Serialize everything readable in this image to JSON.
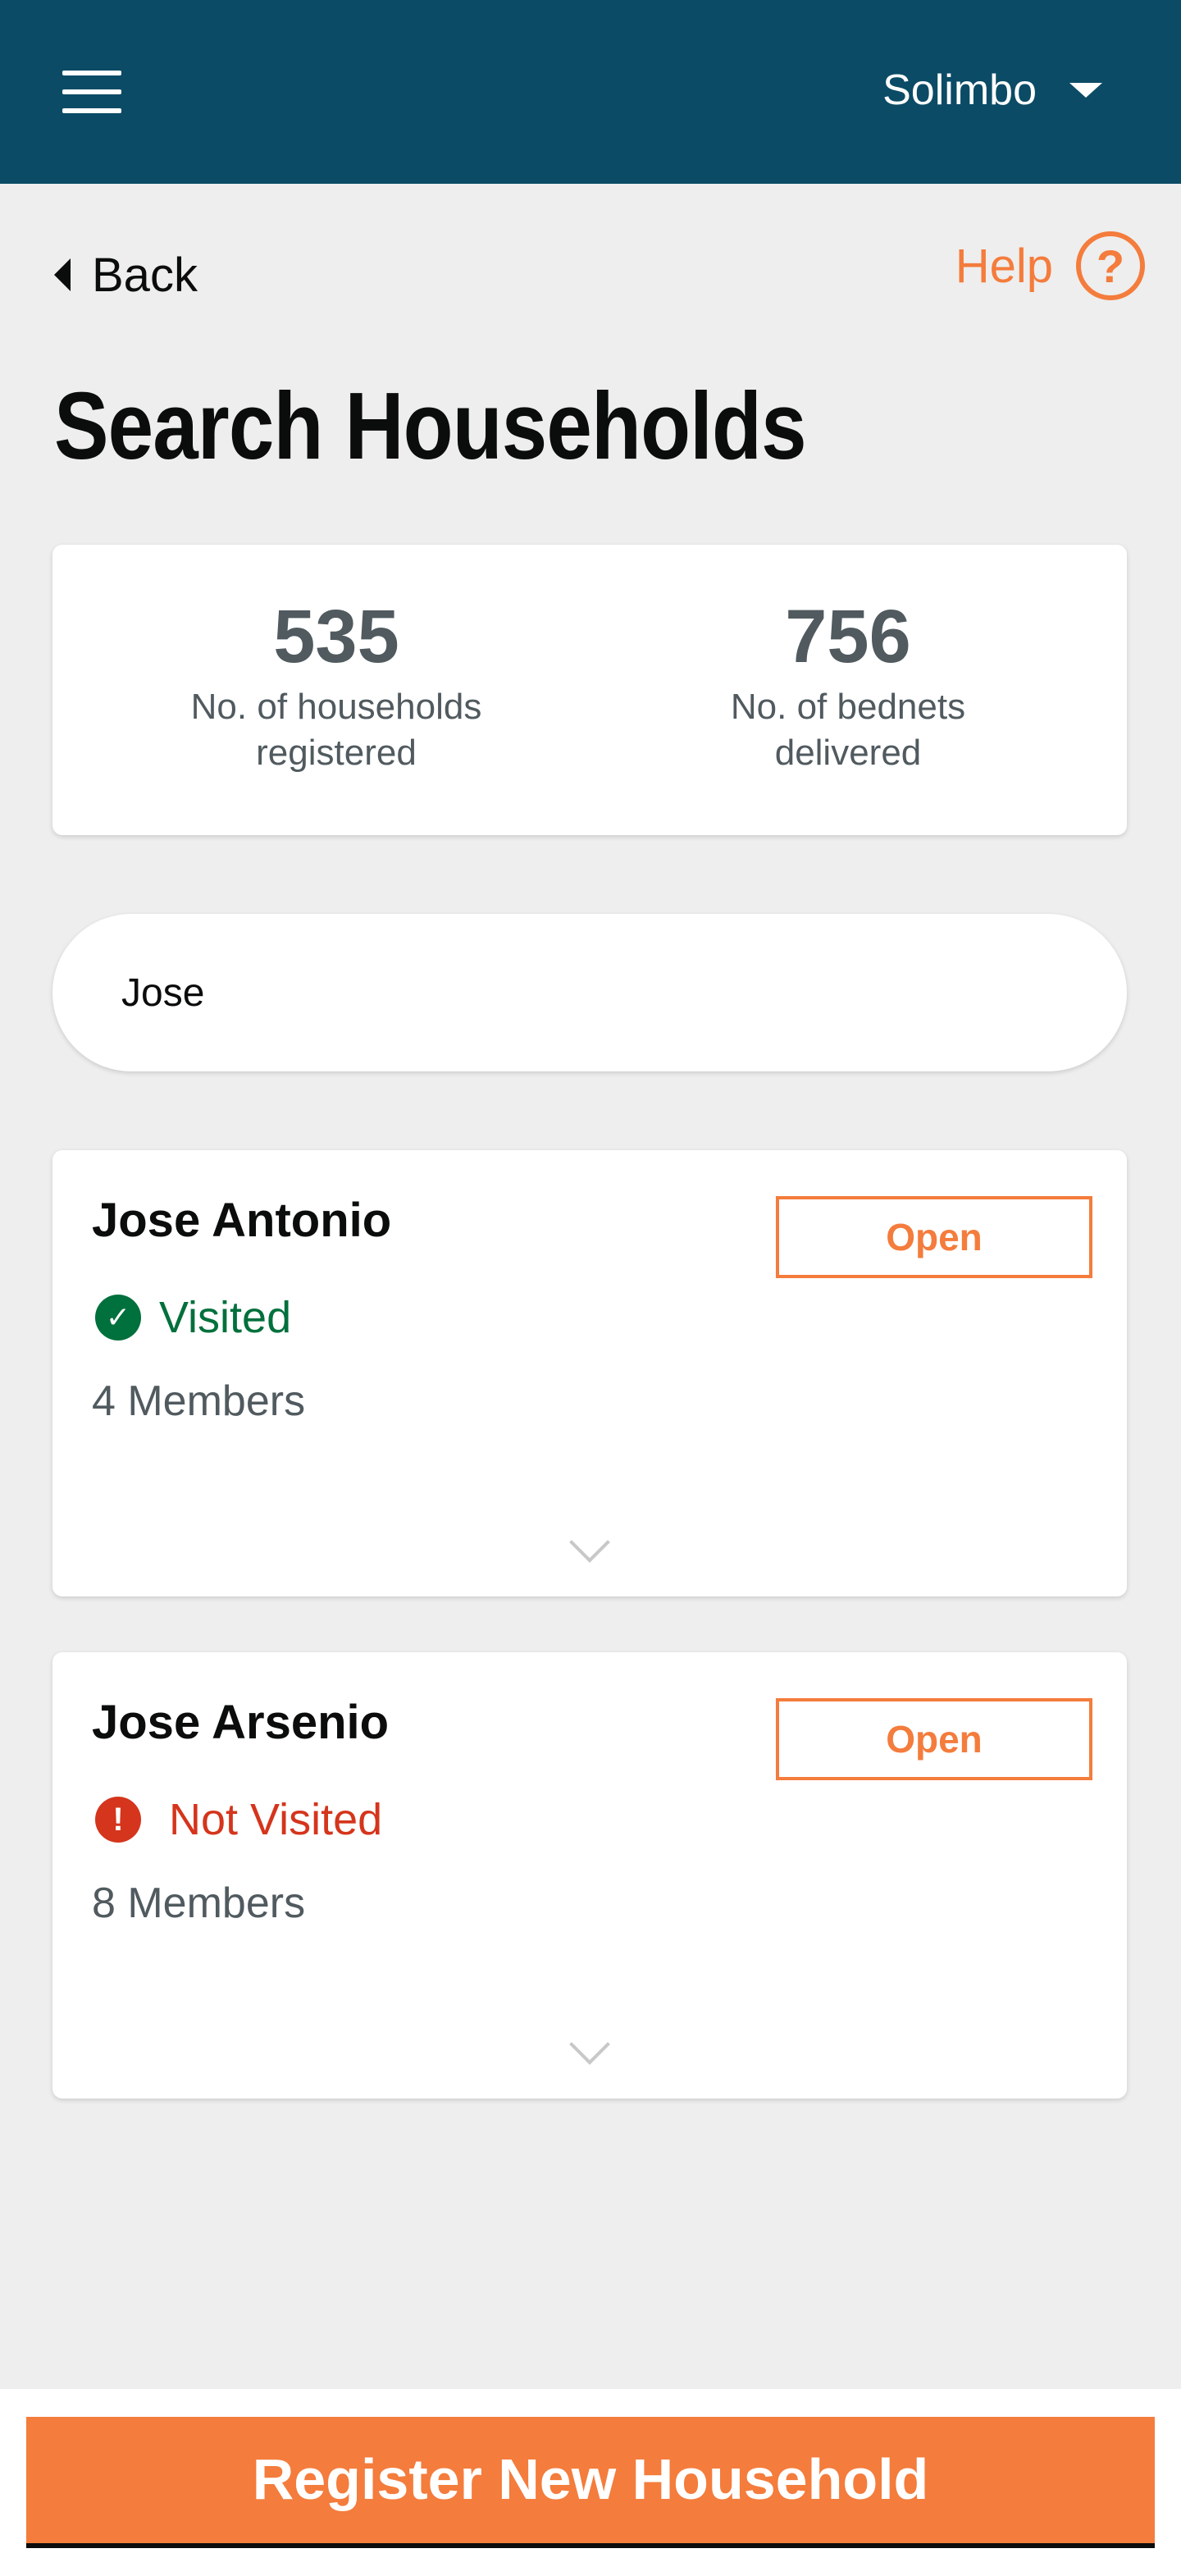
{
  "header": {
    "user_name": "Solimbo"
  },
  "nav": {
    "back_label": "Back",
    "help_label": "Help",
    "help_glyph": "?"
  },
  "page_title": "Search Households",
  "stats": [
    {
      "value": "535",
      "label": "No. of households registered"
    },
    {
      "value": "756",
      "label": "No. of bednets delivered"
    }
  ],
  "search": {
    "value": "Jose"
  },
  "households": [
    {
      "name": "Jose Antonio",
      "status": "Visited",
      "status_icon": "check-circle-icon",
      "status_glyph": "✓",
      "members": "4 Members",
      "open_label": "Open"
    },
    {
      "name": "Jose Arsenio",
      "status": "Not Visited",
      "status_icon": "alert-circle-icon",
      "status_glyph": "!",
      "members": "8 Members",
      "open_label": "Open"
    }
  ],
  "footer": {
    "register_label": "Register New Household"
  },
  "colors": {
    "header_bg": "#0b4b66",
    "accent": "#f47c3c",
    "visited": "#00703c",
    "not_visited": "#d4351c"
  }
}
